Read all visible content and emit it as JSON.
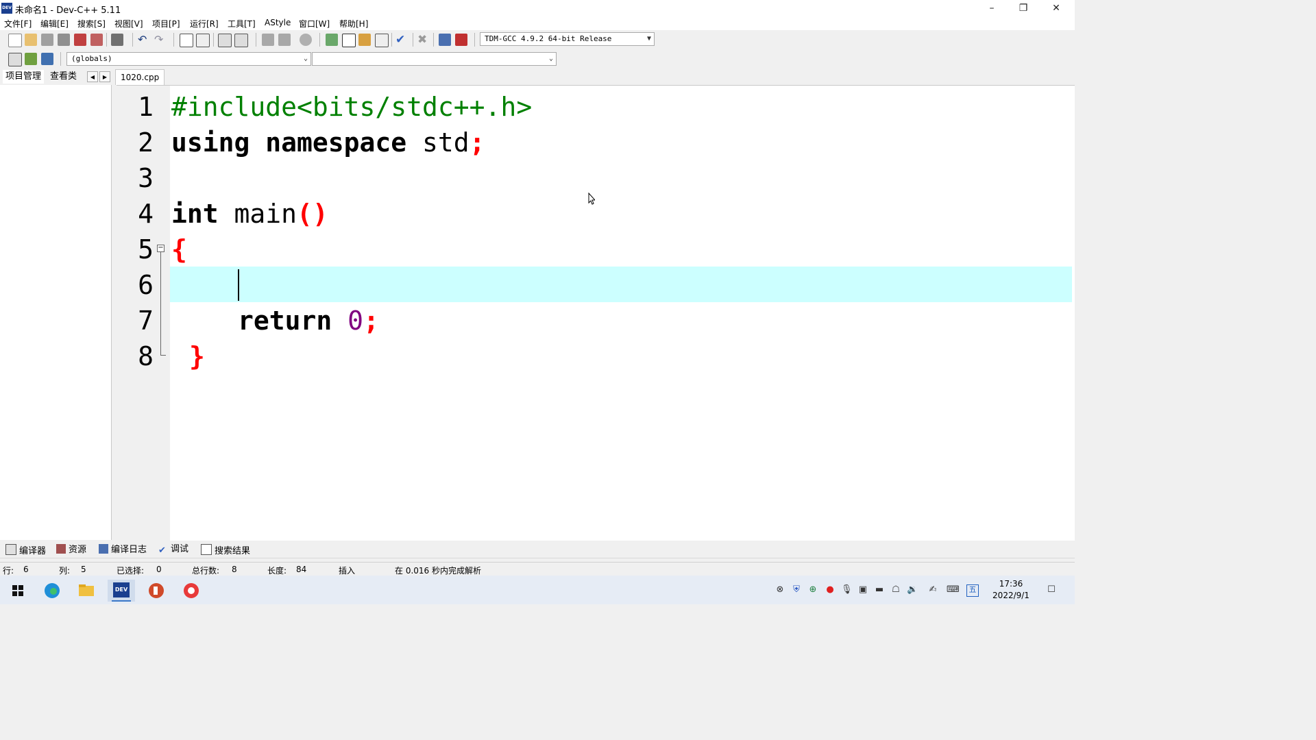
{
  "window": {
    "title": "未命名1 - Dev-C++ 5.11",
    "app_icon_text": "DEV"
  },
  "menu": [
    "文件[F]",
    "编辑[E]",
    "搜索[S]",
    "视图[V]",
    "项目[P]",
    "运行[R]",
    "工具[T]",
    "AStyle",
    "窗口[W]",
    "帮助[H]"
  ],
  "toolbar": {
    "compiler_select": "TDM-GCC 4.9.2 64-bit Release",
    "scope_select": "(globals)",
    "member_select": ""
  },
  "left_panel": {
    "tabs": [
      "项目管理",
      "查看类"
    ]
  },
  "editor": {
    "file_tab": "1020.cpp",
    "line_numbers": [
      "1",
      "2",
      "3",
      "4",
      "5",
      "6",
      "7",
      "8"
    ],
    "lines": {
      "l1": "#include<bits/stdc++.h>",
      "l2_kw": "using namespace",
      "l2_rest": " std",
      "l2_semi": ";",
      "l4_kw": "int",
      "l4_rest": " main",
      "l4_paren": "()",
      "l5": "{",
      "l7_kw": "return",
      "l7_num": "0",
      "l7_semi": ";",
      "l8": "}"
    }
  },
  "bottom_tabs": [
    "编译器",
    "资源",
    "编译日志",
    "调试",
    "搜索结果"
  ],
  "status": {
    "row_label": "行:",
    "row_value": "6",
    "col_label": "列:",
    "col_value": "5",
    "sel_label": "已选择:",
    "sel_value": "0",
    "lines_label": "总行数:",
    "lines_value": "8",
    "len_label": "长度:",
    "len_value": "84",
    "mode": "插入",
    "parse": "在 0.016 秒内完成解析"
  },
  "taskbar": {
    "time": "17:36",
    "date": "2022/9/1",
    "ime": "五",
    "dev_label": "DEV"
  },
  "colors": {
    "preprocessor": "#008000",
    "symbol": "#ff0000",
    "number": "#800080",
    "current_line": "#ccffff"
  }
}
